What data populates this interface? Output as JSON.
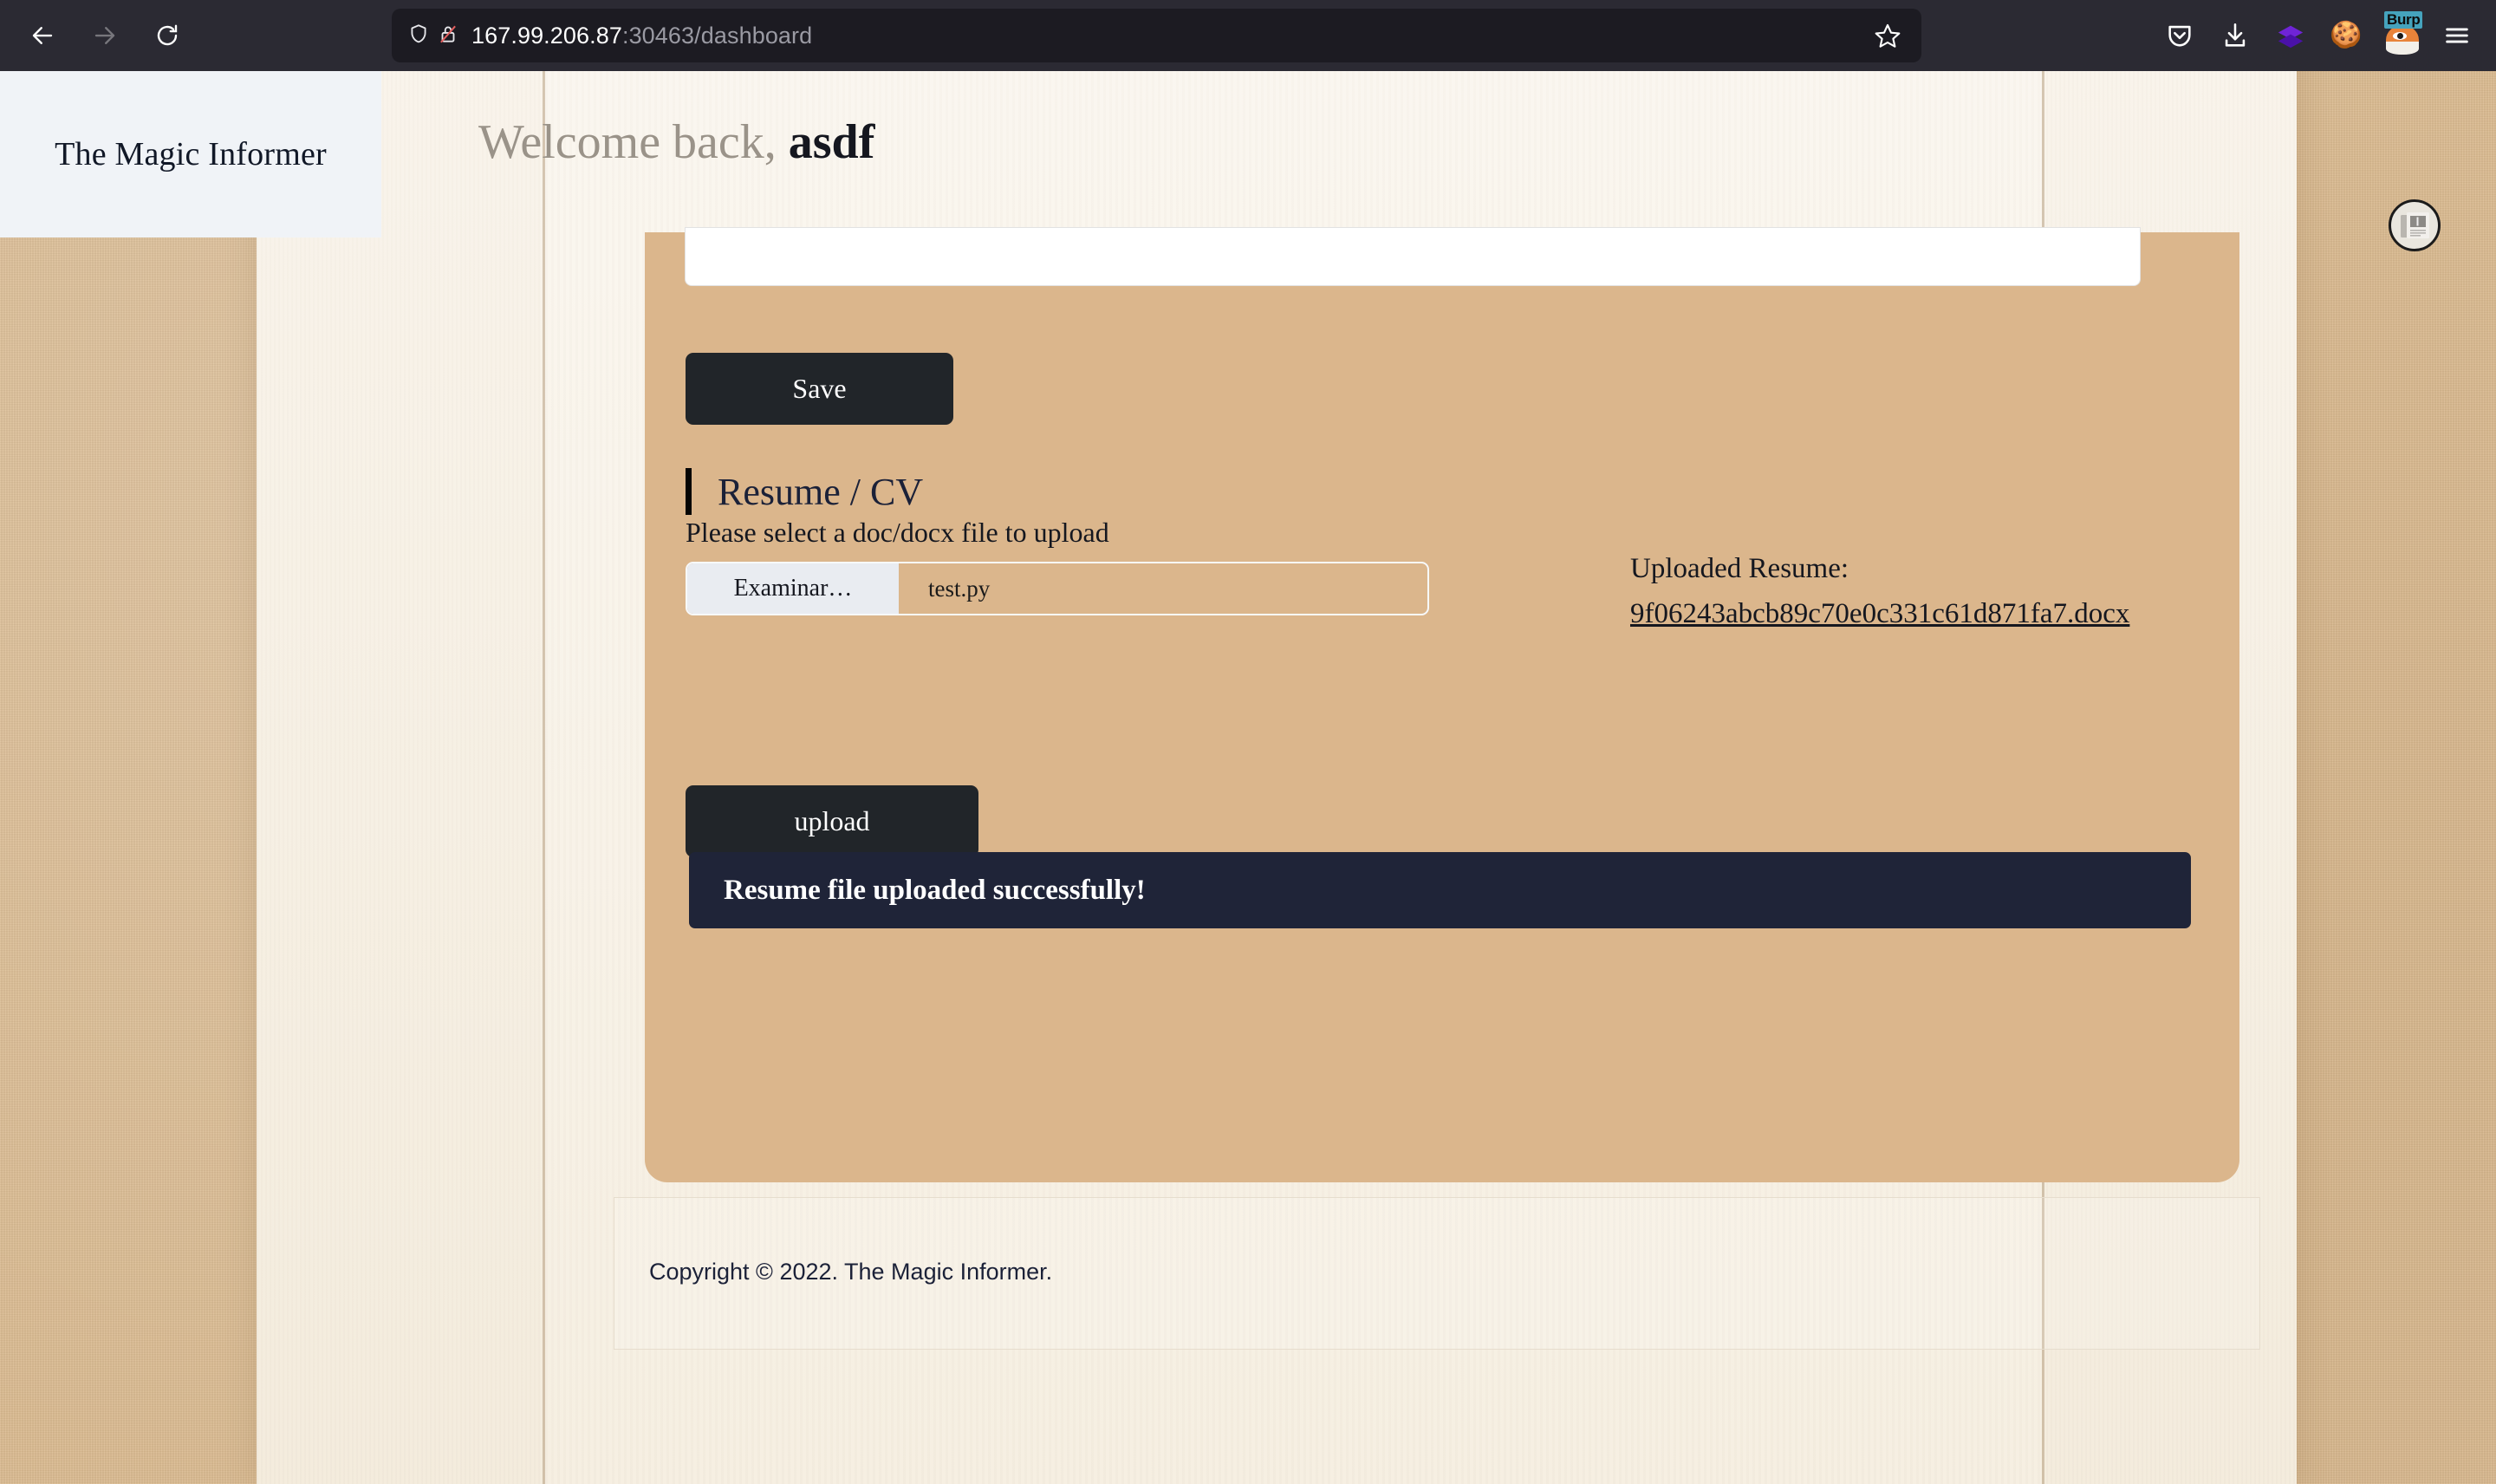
{
  "browser": {
    "back_icon": "back-arrow-icon",
    "forward_icon": "forward-arrow-icon",
    "reload_icon": "reload-icon",
    "shield_icon": "shield-icon",
    "lock_icon": "lock-crossed-icon",
    "url_host": "167.99.206.87",
    "url_rest": ":30463/dashboard",
    "bookmark_icon": "star-icon",
    "toolbar_icons": [
      "pocket-icon",
      "downloads-icon",
      "wappalyzer-icon",
      "cookie-icon",
      "burp-suite-icon",
      "hamburger-menu-icon"
    ],
    "burp_badge": "Burp"
  },
  "header": {
    "brand": "The Magic Informer",
    "welcome_prefix": "Welcome back,",
    "username": "asdf",
    "avatar_icon": "newspaper-avatar-icon"
  },
  "card": {
    "save_label": "Save",
    "section_title": "Resume / CV",
    "upload_label": "Please select a doc/docx file to upload",
    "file_browse_label": "Examinar…",
    "file_name": "test.py",
    "uploaded_label": "Uploaded Resume:",
    "uploaded_file": "9f06243abcb89c70e0c331c61d871fa7.docx",
    "upload_button_label": "upload",
    "alert_message": "Resume file uploaded successfully!"
  },
  "footer": {
    "copyright": "Copyright © 2022. The Magic Informer."
  },
  "colors": {
    "card_bg": "#dbb68c",
    "button_dark": "#212529",
    "alert_bg": "#1f2438",
    "paper_cream": "#f6eee0",
    "paper_kraft": "#dcbc92",
    "brand_panel": "#f0f3f7",
    "accent_bar": "#050505",
    "chrome_bg": "#2b2a33",
    "urlbar_bg": "#1c1b22"
  }
}
